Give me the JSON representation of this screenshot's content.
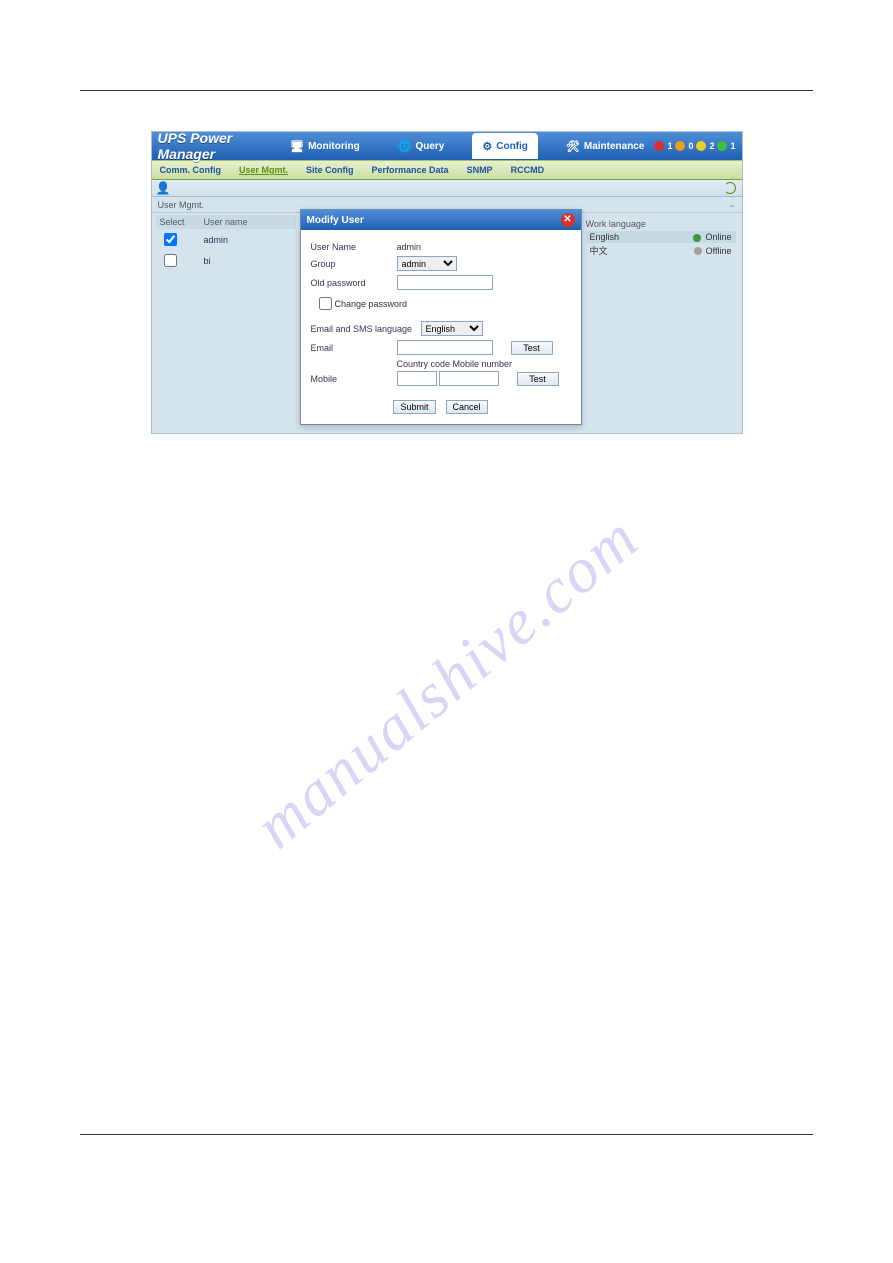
{
  "app": {
    "title": "UPS Power Manager",
    "tabs": {
      "monitoring": "Monitoring",
      "query": "Query",
      "config": "Config",
      "maintenance": "Maintenance"
    },
    "status": {
      "red": "1",
      "orange": "0",
      "yellow": "2",
      "green": "1"
    }
  },
  "subnav": {
    "comm": "Comm. Config",
    "user": "User Mgmt.",
    "site": "Site Config",
    "perf": "Performance Data",
    "snmp": "SNMP",
    "rccmd": "RCCMD"
  },
  "section": {
    "header": "User Mgmt."
  },
  "usertable": {
    "cols": {
      "select": "Select",
      "username": "User name"
    },
    "rows": [
      {
        "name": "admin",
        "checked": true
      },
      {
        "name": "bi",
        "checked": false
      }
    ]
  },
  "langpanel": {
    "header": "Work language",
    "rows": [
      {
        "lang": "English",
        "status": "Online"
      },
      {
        "lang": "中文",
        "status": "Offline"
      }
    ]
  },
  "modal": {
    "title": "Modify User",
    "fields": {
      "username_lbl": "User Name",
      "username_val": "admin",
      "group_lbl": "Group",
      "group_val": "admin",
      "oldpwd_lbl": "Old password",
      "changepwd_lbl": "Change password",
      "emaillang_lbl": "Email and SMS language",
      "emaillang_val": "English",
      "email_lbl": "Email",
      "test_lbl": "Test",
      "ccode_mobile_hdr": "Country code Mobile number",
      "mobile_lbl": "Mobile",
      "submit_lbl": "Submit",
      "cancel_lbl": "Cancel"
    }
  },
  "watermark": "manualshive.com"
}
